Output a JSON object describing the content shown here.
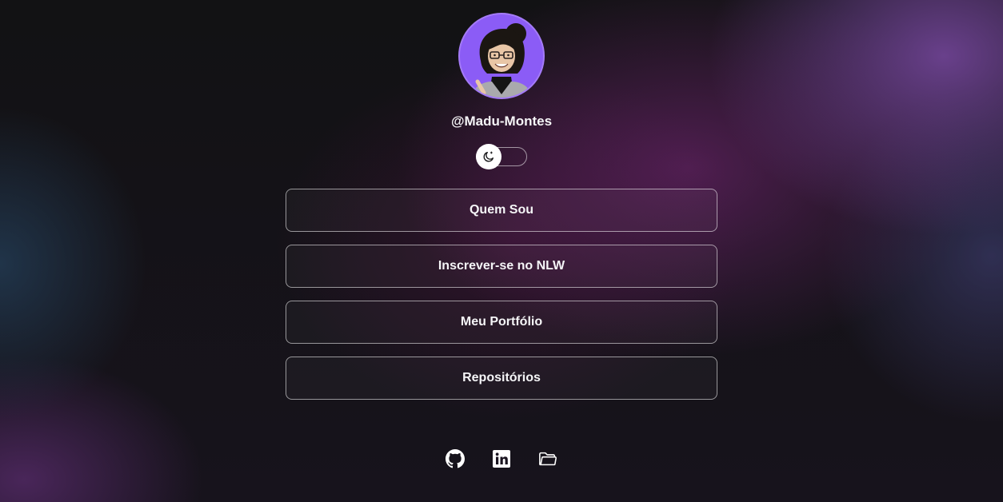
{
  "profile": {
    "avatar_icon": "profile-illustration",
    "handle": "@Madu-Montes"
  },
  "theme_switch": {
    "icon": "moon-icon",
    "mode": "dark"
  },
  "links": [
    {
      "label": "Quem Sou"
    },
    {
      "label": "Inscrever-se no NLW"
    },
    {
      "label": "Meu Portfólio"
    },
    {
      "label": "Repositórios"
    }
  ],
  "social": [
    {
      "icon": "github-icon"
    },
    {
      "icon": "linkedin-icon"
    },
    {
      "icon": "folder-icon"
    }
  ],
  "colors": {
    "avatar_bg": "#8b5cf6",
    "text": "#ffffff",
    "background": "#121214",
    "accent_gradient": "#6b3a8a"
  }
}
